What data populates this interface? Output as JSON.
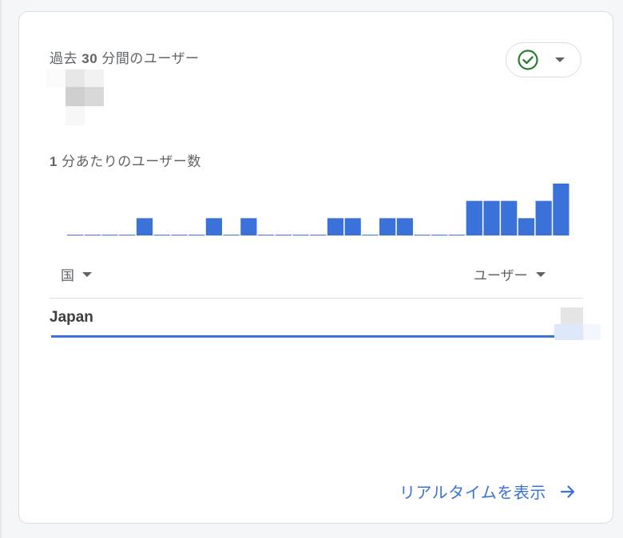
{
  "card": {
    "title_prefix": "過去",
    "title_number": "30",
    "title_suffix": "分間のユーザー",
    "subtitle_number": "1",
    "subtitle_text": "分あたりのユーザー数",
    "status_icon": "check-circle-icon",
    "status_color": "#2e7d32"
  },
  "table": {
    "country_header": "国",
    "users_header": "ユーザー",
    "rows": [
      {
        "country": "Japan",
        "share": 1.0
      }
    ]
  },
  "footer": {
    "link_label": "リアルタイムを表示"
  },
  "chart_data": {
    "type": "bar",
    "title": "",
    "values": [
      0,
      0,
      0,
      0,
      1,
      0,
      0,
      0,
      1,
      0,
      1,
      0,
      0,
      0,
      0,
      1,
      1,
      0,
      1,
      1,
      0,
      0,
      0,
      2,
      2,
      2,
      1,
      2,
      3
    ],
    "ylim": [
      0,
      3
    ],
    "bar_color": "#3b72d9"
  }
}
